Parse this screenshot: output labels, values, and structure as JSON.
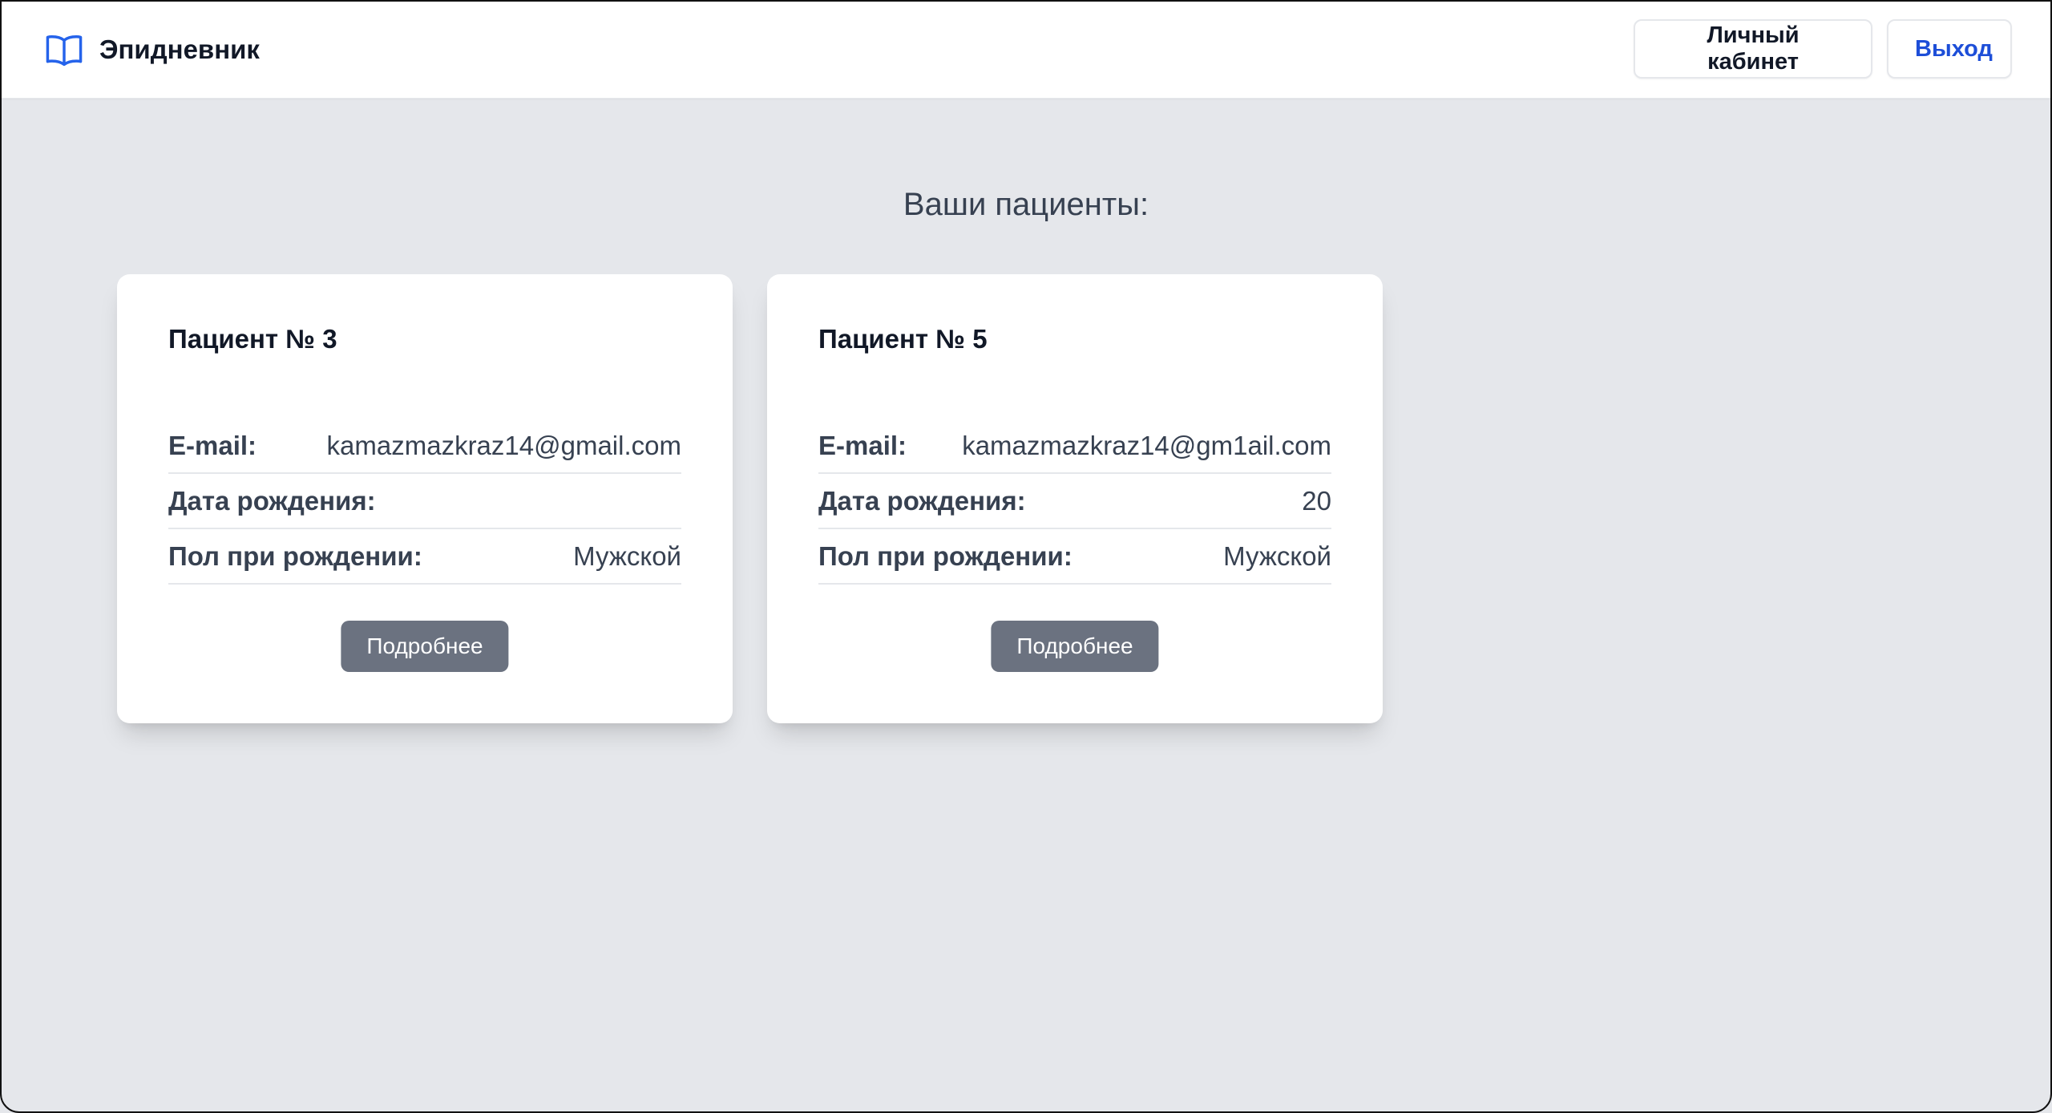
{
  "app": {
    "name": "Эпидневник",
    "icon": "open-book-icon",
    "accent_color": "#2563eb"
  },
  "nav": {
    "cabinet_label": "Личный кабинет",
    "logout_label": "Выход"
  },
  "page": {
    "title": "Ваши пациенты:"
  },
  "labels": {
    "email": "E-mail:",
    "birth_date": "Дата рождения:",
    "sex_at_birth": "Пол при рождении:",
    "details": "Подробнее"
  },
  "patients": [
    {
      "title": "Пациент № 3",
      "email": "kamazmazkraz14@gmail.com",
      "birth_date": "",
      "sex_at_birth": "Мужской"
    },
    {
      "title": "Пациент № 5",
      "email": "kamazmazkraz14@gm1ail.com",
      "birth_date": "20",
      "sex_at_birth": "Мужской"
    }
  ]
}
